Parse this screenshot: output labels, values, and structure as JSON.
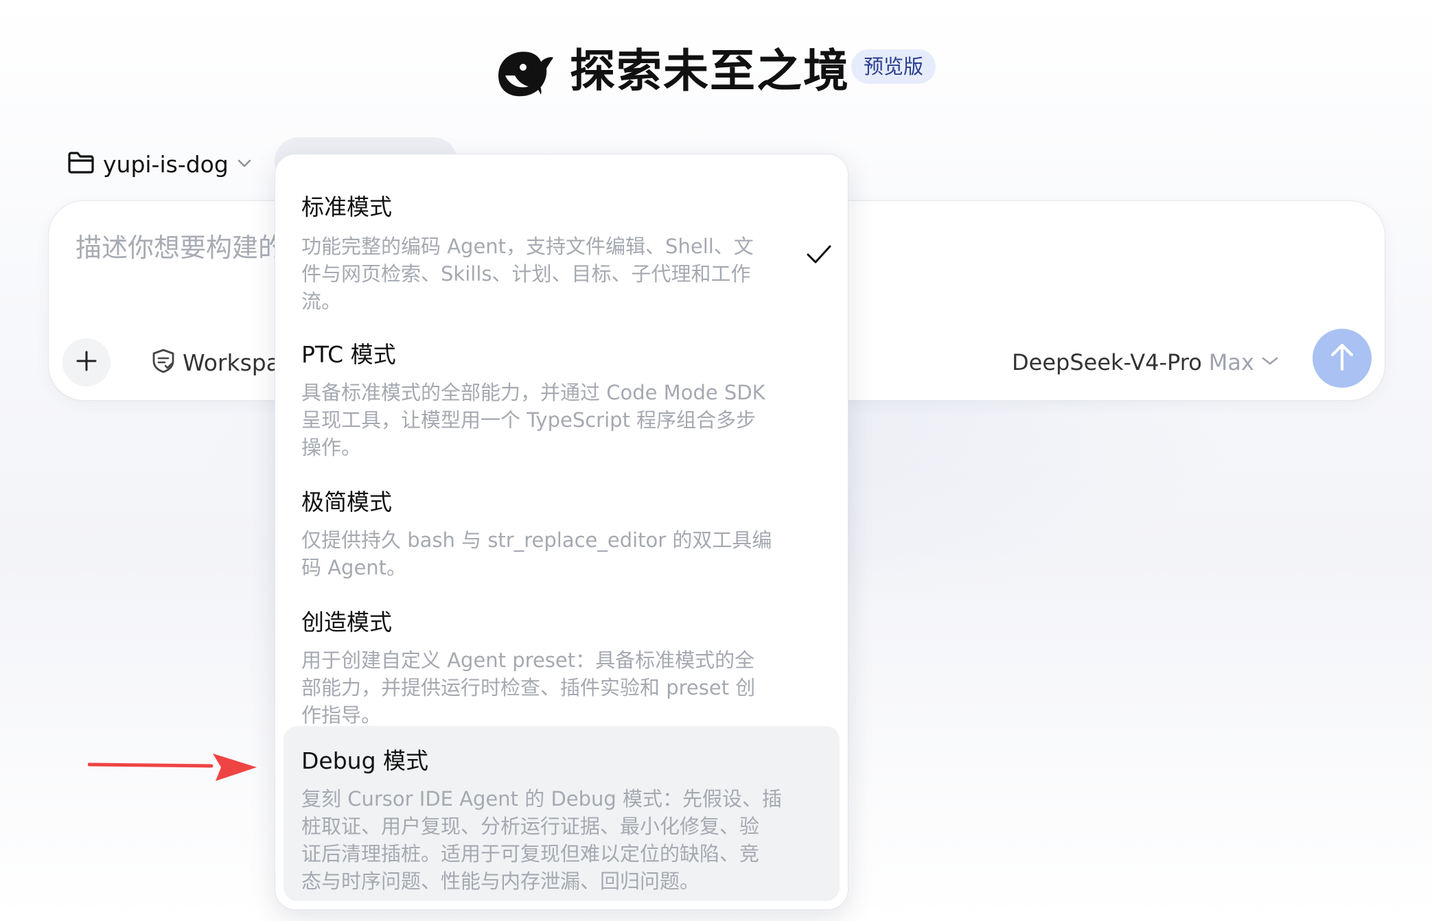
{
  "header": {
    "logo_icon": "whale-logo-icon",
    "title": "探索未至之境",
    "badge": "预览版"
  },
  "folder": {
    "name": "yupi-is-dog",
    "icon": "folder-icon"
  },
  "composer": {
    "placeholder_visible": "描述你想要构建的",
    "workspace_label": "Workspa",
    "model_name": "DeepSeek-V4-Pro",
    "model_tier": "Max",
    "send_icon": "arrow-up-icon",
    "plus_icon": "plus-icon"
  },
  "mode_menu": {
    "selected": "标准模式",
    "items": [
      {
        "title": "标准模式",
        "desc_lines": [
          "功能完整的编码 Agent，支持文件编辑、Shell、文",
          "件与网页检索、Skills、计划、目标、子代理和工作",
          "流。"
        ]
      },
      {
        "title": "PTC 模式",
        "desc_lines": [
          "具备标准模式的全部能力，并通过 Code Mode SDK",
          "呈现工具，让模型用一个 TypeScript 程序组合多步",
          "操作。"
        ]
      },
      {
        "title": "极简模式",
        "desc_lines": [
          "仅提供持久 bash 与 str_replace_editor 的双工具编",
          "码 Agent。"
        ]
      },
      {
        "title": "创造模式",
        "desc_lines": [
          "用于创建自定义 Agent preset：具备标准模式的全",
          "部能力，并提供运行时检查、插件实验和 preset 创",
          "作指导。"
        ]
      },
      {
        "title": "Debug 模式",
        "desc_lines": [
          "复刻 Cursor IDE Agent 的 Debug 模式：先假设、插",
          "桩取证、用户复现、分析运行证据、最小化修复、验",
          "证后清理插桩。适用于可复现但难以定位的缺陷、竞",
          "态与时序问题、性能与内存泄漏、回归问题。"
        ]
      }
    ]
  },
  "colors": {
    "send_button": "#a9c1f3",
    "badge_bg": "#e6ecfb",
    "badge_text": "#2b3f8f",
    "arrow": "#ef4444",
    "highlight": "#f1f2f4"
  }
}
